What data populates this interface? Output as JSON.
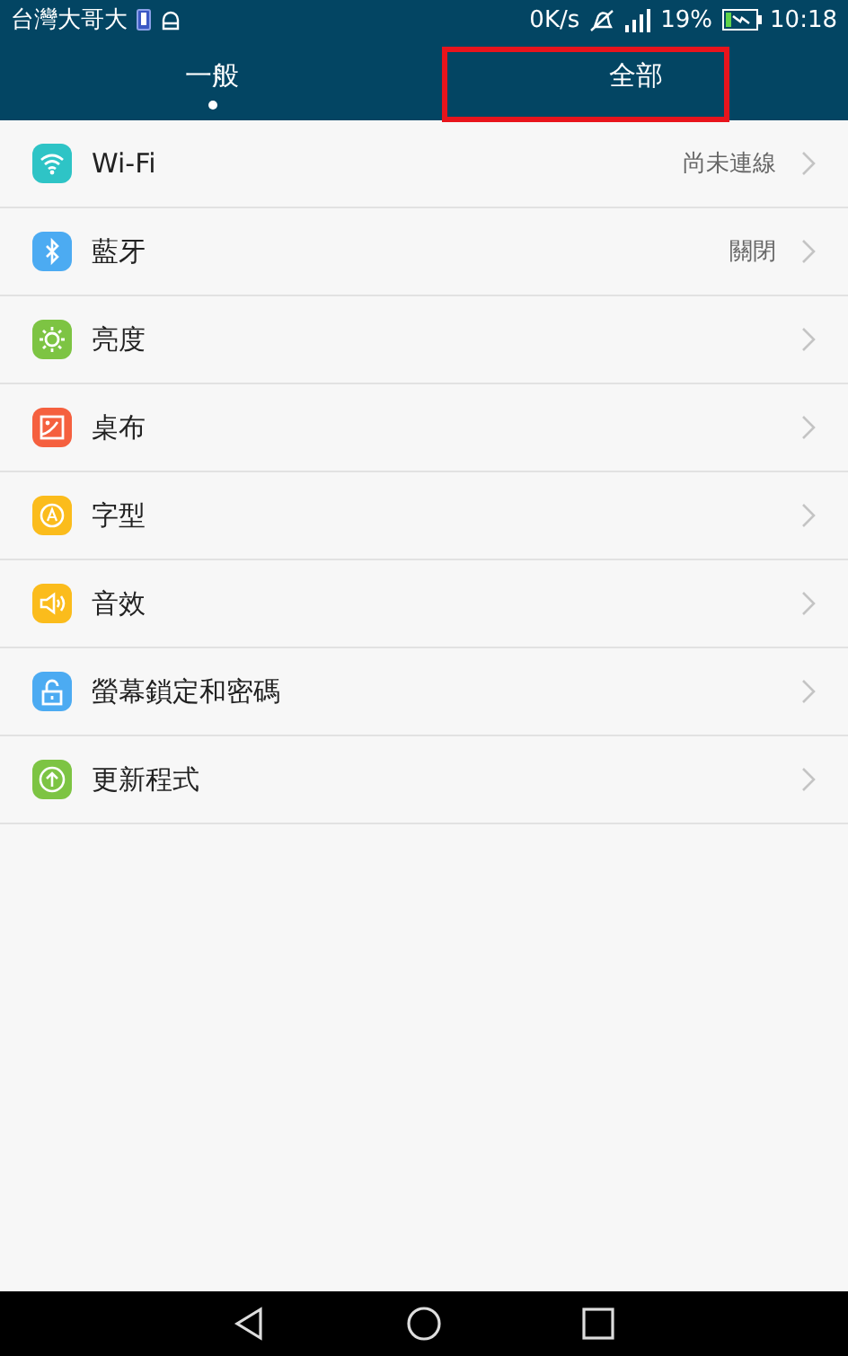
{
  "status_bar": {
    "carrier": "台灣大哥大",
    "speed": "0K/s",
    "battery": "19%",
    "time": "10:18"
  },
  "tabs": [
    {
      "label": "一般",
      "selected": true,
      "annotated": false
    },
    {
      "label": "全部",
      "selected": false,
      "annotated": true
    }
  ],
  "settings": [
    {
      "kind": "wifi",
      "color": "#2ec4c6",
      "label": "Wi-Fi",
      "value": "尚未連線"
    },
    {
      "kind": "bluetooth",
      "color": "#4cabf2",
      "label": "藍牙",
      "value": "關閉"
    },
    {
      "kind": "brightness",
      "color": "#7dc443",
      "label": "亮度"
    },
    {
      "kind": "wallpaper",
      "color": "#f5603f",
      "label": "桌布"
    },
    {
      "kind": "font",
      "color": "#fbbc1c",
      "label": "字型"
    },
    {
      "kind": "sound",
      "color": "#fbbc1c",
      "label": "音效"
    },
    {
      "kind": "lock",
      "color": "#4cabf2",
      "label": "螢幕鎖定和密碼"
    },
    {
      "kind": "update",
      "color": "#7dc443",
      "label": "更新程式"
    }
  ]
}
